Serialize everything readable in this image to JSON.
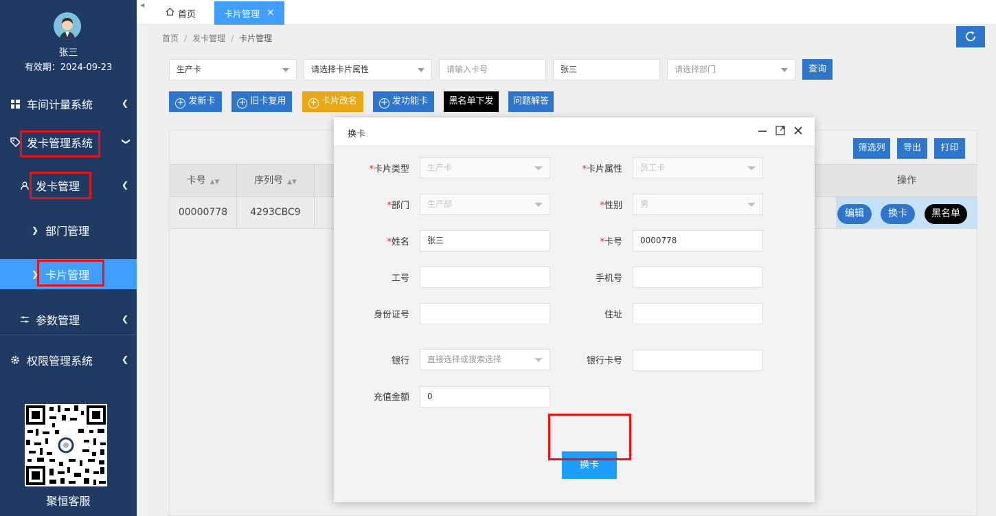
{
  "sidebar": {
    "user_name": "张三",
    "user_expiry": "有效期：2024-09-23",
    "items": [
      {
        "label": "车间计量系统"
      },
      {
        "label": "发卡管理系统"
      },
      {
        "label": "发卡管理"
      },
      {
        "label": "部门管理"
      },
      {
        "label": "卡片管理"
      },
      {
        "label": "参数管理"
      },
      {
        "label": "权限管理系统"
      }
    ],
    "qr_label": "聚恒客服"
  },
  "tabs": {
    "home": "首页",
    "active": "卡片管理",
    "close_symbol": "✕"
  },
  "breadcrumb": [
    "首页",
    "发卡管理",
    "卡片管理"
  ],
  "filters": {
    "card_type_value": "生产卡",
    "card_attr_placeholder": "请选择卡片属性",
    "card_no_placeholder": "请输入卡号",
    "name_value": "张三",
    "dept_placeholder": "请选择部门",
    "query_label": "查询"
  },
  "actions": {
    "issue_new": "发新卡",
    "reuse_old": "旧卡复用",
    "rename": "卡片改名",
    "function_card": "发功能卡",
    "blacklist_issue": "黑名单下发",
    "faq": "问题解答"
  },
  "table": {
    "toolbar": {
      "filter_cols": "筛选列",
      "export": "导出",
      "print": "打印"
    },
    "columns": [
      "卡号",
      "序列号",
      "操作"
    ],
    "rows": [
      {
        "card_no": "00000778",
        "serial": "4293CBC9",
        "ops": [
          "编辑",
          "换卡",
          "黑名单"
        ]
      }
    ]
  },
  "modal": {
    "title": "换卡",
    "fields": {
      "card_type": {
        "label": "卡片类型",
        "value": "生产卡"
      },
      "card_attr": {
        "label": "卡片属性",
        "value": "员工卡"
      },
      "dept": {
        "label": "部门",
        "value": "生产部"
      },
      "gender": {
        "label": "性别",
        "value": "男"
      },
      "name": {
        "label": "姓名",
        "value": "张三"
      },
      "card_no": {
        "label": "卡号",
        "value": "0000778"
      },
      "emp_no": {
        "label": "工号",
        "value": ""
      },
      "phone": {
        "label": "手机号",
        "value": ""
      },
      "id_no": {
        "label": "身份证号",
        "value": ""
      },
      "address": {
        "label": "住址",
        "value": ""
      },
      "bank": {
        "label": "银行",
        "placeholder": "直接选择或搜索选择"
      },
      "bank_card_no": {
        "label": "银行卡号",
        "value": ""
      },
      "recharge": {
        "label": "充值金额",
        "value": "0"
      }
    },
    "required_mark": "*",
    "submit": "换卡"
  },
  "colors": {
    "sidebar_bg": "#1f3b63",
    "accent": "#409eff",
    "primary_btn": "#2e75cc",
    "warning_btn": "#e6a817",
    "black_btn": "#000000",
    "highlight_red": "#ee1111"
  }
}
